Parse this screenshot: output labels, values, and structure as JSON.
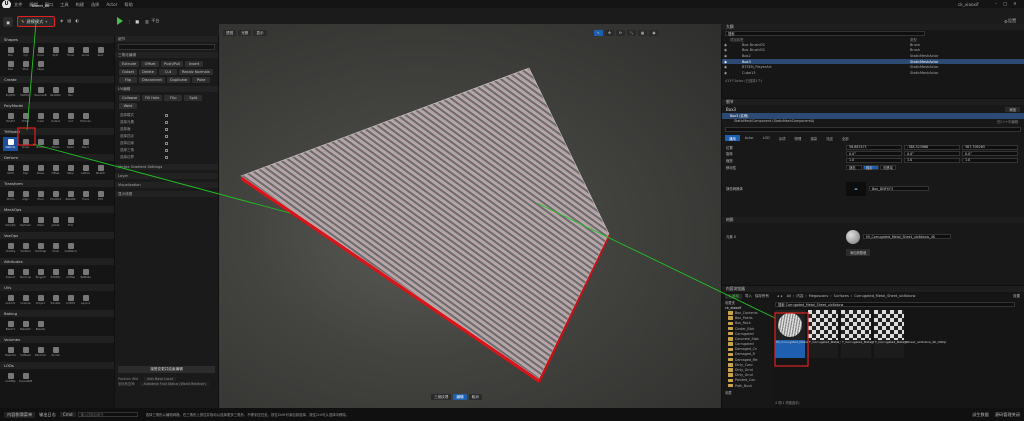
{
  "menu": [
    "文件",
    "编辑",
    "窗口",
    "工具",
    "构建",
    "选择",
    "Actor",
    "帮助"
  ],
  "window": {
    "tab": "Sweet_Ell",
    "project": "ck_xiaoxif",
    "settings": "设置"
  },
  "toolbar": {
    "mode": "建模模式",
    "platform": "平台"
  },
  "modeling": {
    "categories": [
      {
        "name": "Shapes",
        "tools": [
          "Box",
          "Cyl",
          "Cone",
          "Sphr",
          "Torus",
          "Arrow",
          "Rect",
          "Disc",
          "Stair",
          "Capsl"
        ]
      },
      {
        "name": "Create",
        "tools": [
          "PolyExt",
          "PathExt",
          "RevolveB",
          "RevPath",
          "Pen"
        ]
      },
      {
        "name": "PolyModel",
        "tools": [
          "PolyEd",
          "TriSel",
          "Inset",
          "Outset",
          "Cut",
          "Extrude"
        ]
      },
      {
        "name": "TriModel",
        "tools": [
          "Deform",
          "Draw",
          "Norms",
          "Filters",
          "Relax",
          "Bend"
        ],
        "selected": 0
      },
      {
        "name": "Deform",
        "tools": [
          "Smth",
          "Dsp",
          "Noise",
          "Offset",
          "Warp",
          "Lattice",
          "Stretch"
        ]
      },
      {
        "name": "Transform",
        "tools": [
          "Xform",
          "Align",
          "Pivot",
          "PivotAct",
          "BakeRS",
          "Trans",
          "Edit"
        ]
      },
      {
        "name": "MeshOps",
        "tools": [
          "Simplify",
          "Remesh",
          "Weld",
          "Jacket",
          "Trim"
        ]
      },
      {
        "name": "VoxOps",
        "tools": [
          "VoxMrg",
          "VoxBool",
          "VoxWrap",
          "Voxel",
          "VoxBlend"
        ]
      },
      {
        "name": "Attributes",
        "tools": [
          "Inspect",
          "Normals",
          "Tangent",
          "EditAttr",
          "UVMap",
          "TexBake"
        ]
      },
      {
        "name": "UVs",
        "tools": [
          "AutoUV",
          "Unwrap",
          "Project",
          "Transfer",
          "UVEdit",
          "Layout"
        ]
      },
      {
        "name": "Baking",
        "tools": [
          "BakeTx",
          "BakeVtx",
          "BakeRs"
        ]
      },
      {
        "name": "Volumes",
        "tools": [
          "MeshVol",
          "VolMesh",
          "BlockVol",
          "Tunnel"
        ]
      },
      {
        "name": "LODs",
        "tools": [
          "LODMgr",
          "ImposterB"
        ]
      }
    ]
  },
  "props": {
    "title": "细节",
    "sections": [
      {
        "label": "三角化编辑",
        "buttons": [
          "Extrude",
          "Offset",
          "Push/Pull",
          "Insert",
          "Outset",
          "Delete",
          "Cut",
          "Recalc Normals",
          "Flip",
          "Disconnect",
          "Duplicate",
          "Poke"
        ]
      },
      {
        "label": "UV编辑",
        "buttons": [
          "Collapse",
          "Fill Hole",
          "Flip",
          "Split",
          "Weld"
        ]
      }
    ],
    "rows": [
      {
        "label": "选择模式",
        "checked": false
      },
      {
        "label": "选择元素",
        "checked": false
      },
      {
        "label": "选择面",
        "checked": false
      },
      {
        "label": "选择顶点",
        "checked": false
      },
      {
        "label": "选择边缘",
        "checked": false
      },
      {
        "label": "选择三角",
        "checked": false
      },
      {
        "label": "选择边界",
        "checked": false
      }
    ],
    "extra": [
      "Vertex Gradient Settings",
      "Layer",
      "Visualization",
      "显示线框"
    ],
    "accept": "接受变更并结束编辑",
    "bottom": {
      "label": "坐标系空间",
      "value": "Axis Base Local",
      "world": "Position Wld",
      "fold": "Autodesk Fold Status (World Relative)"
    }
  },
  "viewport": {
    "chips": [
      "透视",
      "光照",
      "显示"
    ],
    "bottomchips": [
      "三维纹理",
      "编辑",
      "取消"
    ]
  },
  "outliner": {
    "title": "大纲",
    "search": "搜索",
    "cols": [
      "项目标签",
      "类型"
    ],
    "rows": [
      {
        "name": "Box BrushOS",
        "type": "Brush"
      },
      {
        "name": "Box BrushOS",
        "type": "Brush"
      },
      {
        "name": "Box2",
        "type": "StaticMeshActor"
      },
      {
        "name": "Box3",
        "type": "StaticMeshActor",
        "sel": true
      },
      {
        "name": "BTSEN_PlayerArt",
        "type": "StaticMeshActor"
      },
      {
        "name": "Cube13",
        "type": "StaticMeshActor"
      }
    ],
    "footer": "413个Actor (已选择1个)"
  },
  "details": {
    "title": "细节",
    "actor": "Box3",
    "addBtn": "添加",
    "instance": "Box3 (实例)",
    "component": "StaticMeshComponent (StaticMeshComponent0)",
    "componentEdit": "在C++中编辑",
    "tabs": [
      "通用",
      "Actor",
      "LOD",
      "杂项",
      "物理",
      "渲染",
      "流送",
      "全部"
    ],
    "transform": [
      {
        "label": "位置",
        "x": "58.887471",
        "y": "-768.323966",
        "z": "367.709265"
      },
      {
        "label": "旋转",
        "x": "0.0°",
        "y": "0.0°",
        "z": "0.0°"
      },
      {
        "label": "缩放",
        "x": "1.0",
        "y": "1.0",
        "z": "1.0"
      }
    ],
    "mobility": {
      "label": "移动性",
      "opts": [
        "静态",
        "固定",
        "可移动"
      ]
    },
    "meshLabel": "静态网格体",
    "mesh": "Box_DNFXY3",
    "materialsHdr": "材质",
    "elementLabel": "元素 0",
    "material": "MI_Corrugated_Metal_Sheet_ulc6xbcw_4K",
    "matBtn": "添加到数组"
  },
  "content": {
    "title": "内容浏览器",
    "add": "添加",
    "import": "导入",
    "save": "保存所有",
    "path": [
      "All",
      "内容",
      "Megascans",
      "Surfaces",
      "Corrugated_Metal_Sheet_ulc6xbcw"
    ],
    "settings": "设置",
    "favorites": "收藏夹",
    "project": "ck_xiaoxif",
    "search": "搜索 Corrugated_Metal_Sheet_ulc6xbcw",
    "folders": [
      "Box_Contents",
      "Box_Paints",
      "Box_Rock",
      "Cinder_Blck",
      "Corrugated",
      "Concrete_Slab",
      "Corrugated",
      "Damaged_Cn",
      "Damaged_R",
      "Damaged_Me",
      "Dirty_Conc",
      "Dirty_Grnd",
      "Dirty_Grnd",
      "Painted_Con",
      "Path_Bush"
    ],
    "assets": [
      {
        "name": "MI_Corrugated_Metal_Sheet_ulc6xbcw_4K",
        "sel": true
      },
      {
        "name": "T_Corrugated_Metal_Sheet_ulc6xbcw_4K_D"
      },
      {
        "name": "T_Corrugated_Metal_Sheet_ulc6xbcw_4K_N"
      },
      {
        "name": "T_Corrugated_Metal_Sheet_ulc6xbcw_4K_ORDp"
      }
    ],
    "footer": "4 项(1 项被选中)",
    "collections": "收藏"
  },
  "status": {
    "drawer": "内容侧滑菜单",
    "log": "输出日志",
    "cmd": "Cmd",
    "cmdPlaceholder": "输入控制台命令",
    "hint": "选择三角形以编辑网格。在三角形上按住并拖动以选择更多三角形，不移到空白处。按住Shift可添加到选择，按住Ctrl可从选择中移除。",
    "derived": "派生数据",
    "source": "源码管理关闭"
  },
  "colors": {
    "accent": "#1f5fb0",
    "red": "#e02020",
    "green": "#21c323",
    "play": "#45c04b"
  }
}
